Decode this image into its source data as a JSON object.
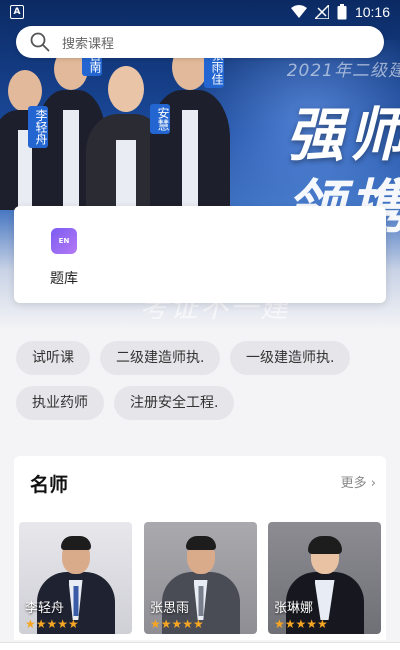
{
  "status_bar": {
    "time": "10:16",
    "left_icon": "A"
  },
  "search": {
    "placeholder": "搜索课程"
  },
  "banner": {
    "year_text": "2021年二级建",
    "headline_1": "强师",
    "headline_2": "领携",
    "headline_3": "考证不一建",
    "name_tags": [
      "李轻舟",
      "吉南",
      "安慧",
      "张雨佳"
    ]
  },
  "quick_entry": {
    "items": [
      {
        "label": "题库",
        "icon_text": "EN",
        "icon": "question-bank-icon"
      }
    ]
  },
  "tags": [
    "试听课",
    "二级建造师执.",
    "一级建造师执.",
    "执业药师",
    "注册安全工程."
  ],
  "teachers_section": {
    "title": "名师",
    "more_label": "更多",
    "teachers": [
      {
        "name": "李轻舟",
        "rating": 5
      },
      {
        "name": "张思雨",
        "rating": 5
      },
      {
        "name": "张琳娜",
        "rating": 5
      }
    ],
    "star_glyphs": "★★★★★"
  },
  "colors": {
    "accent": "#2366d1",
    "star": "#f6a623",
    "icon_purple": "#7b5bf2"
  }
}
